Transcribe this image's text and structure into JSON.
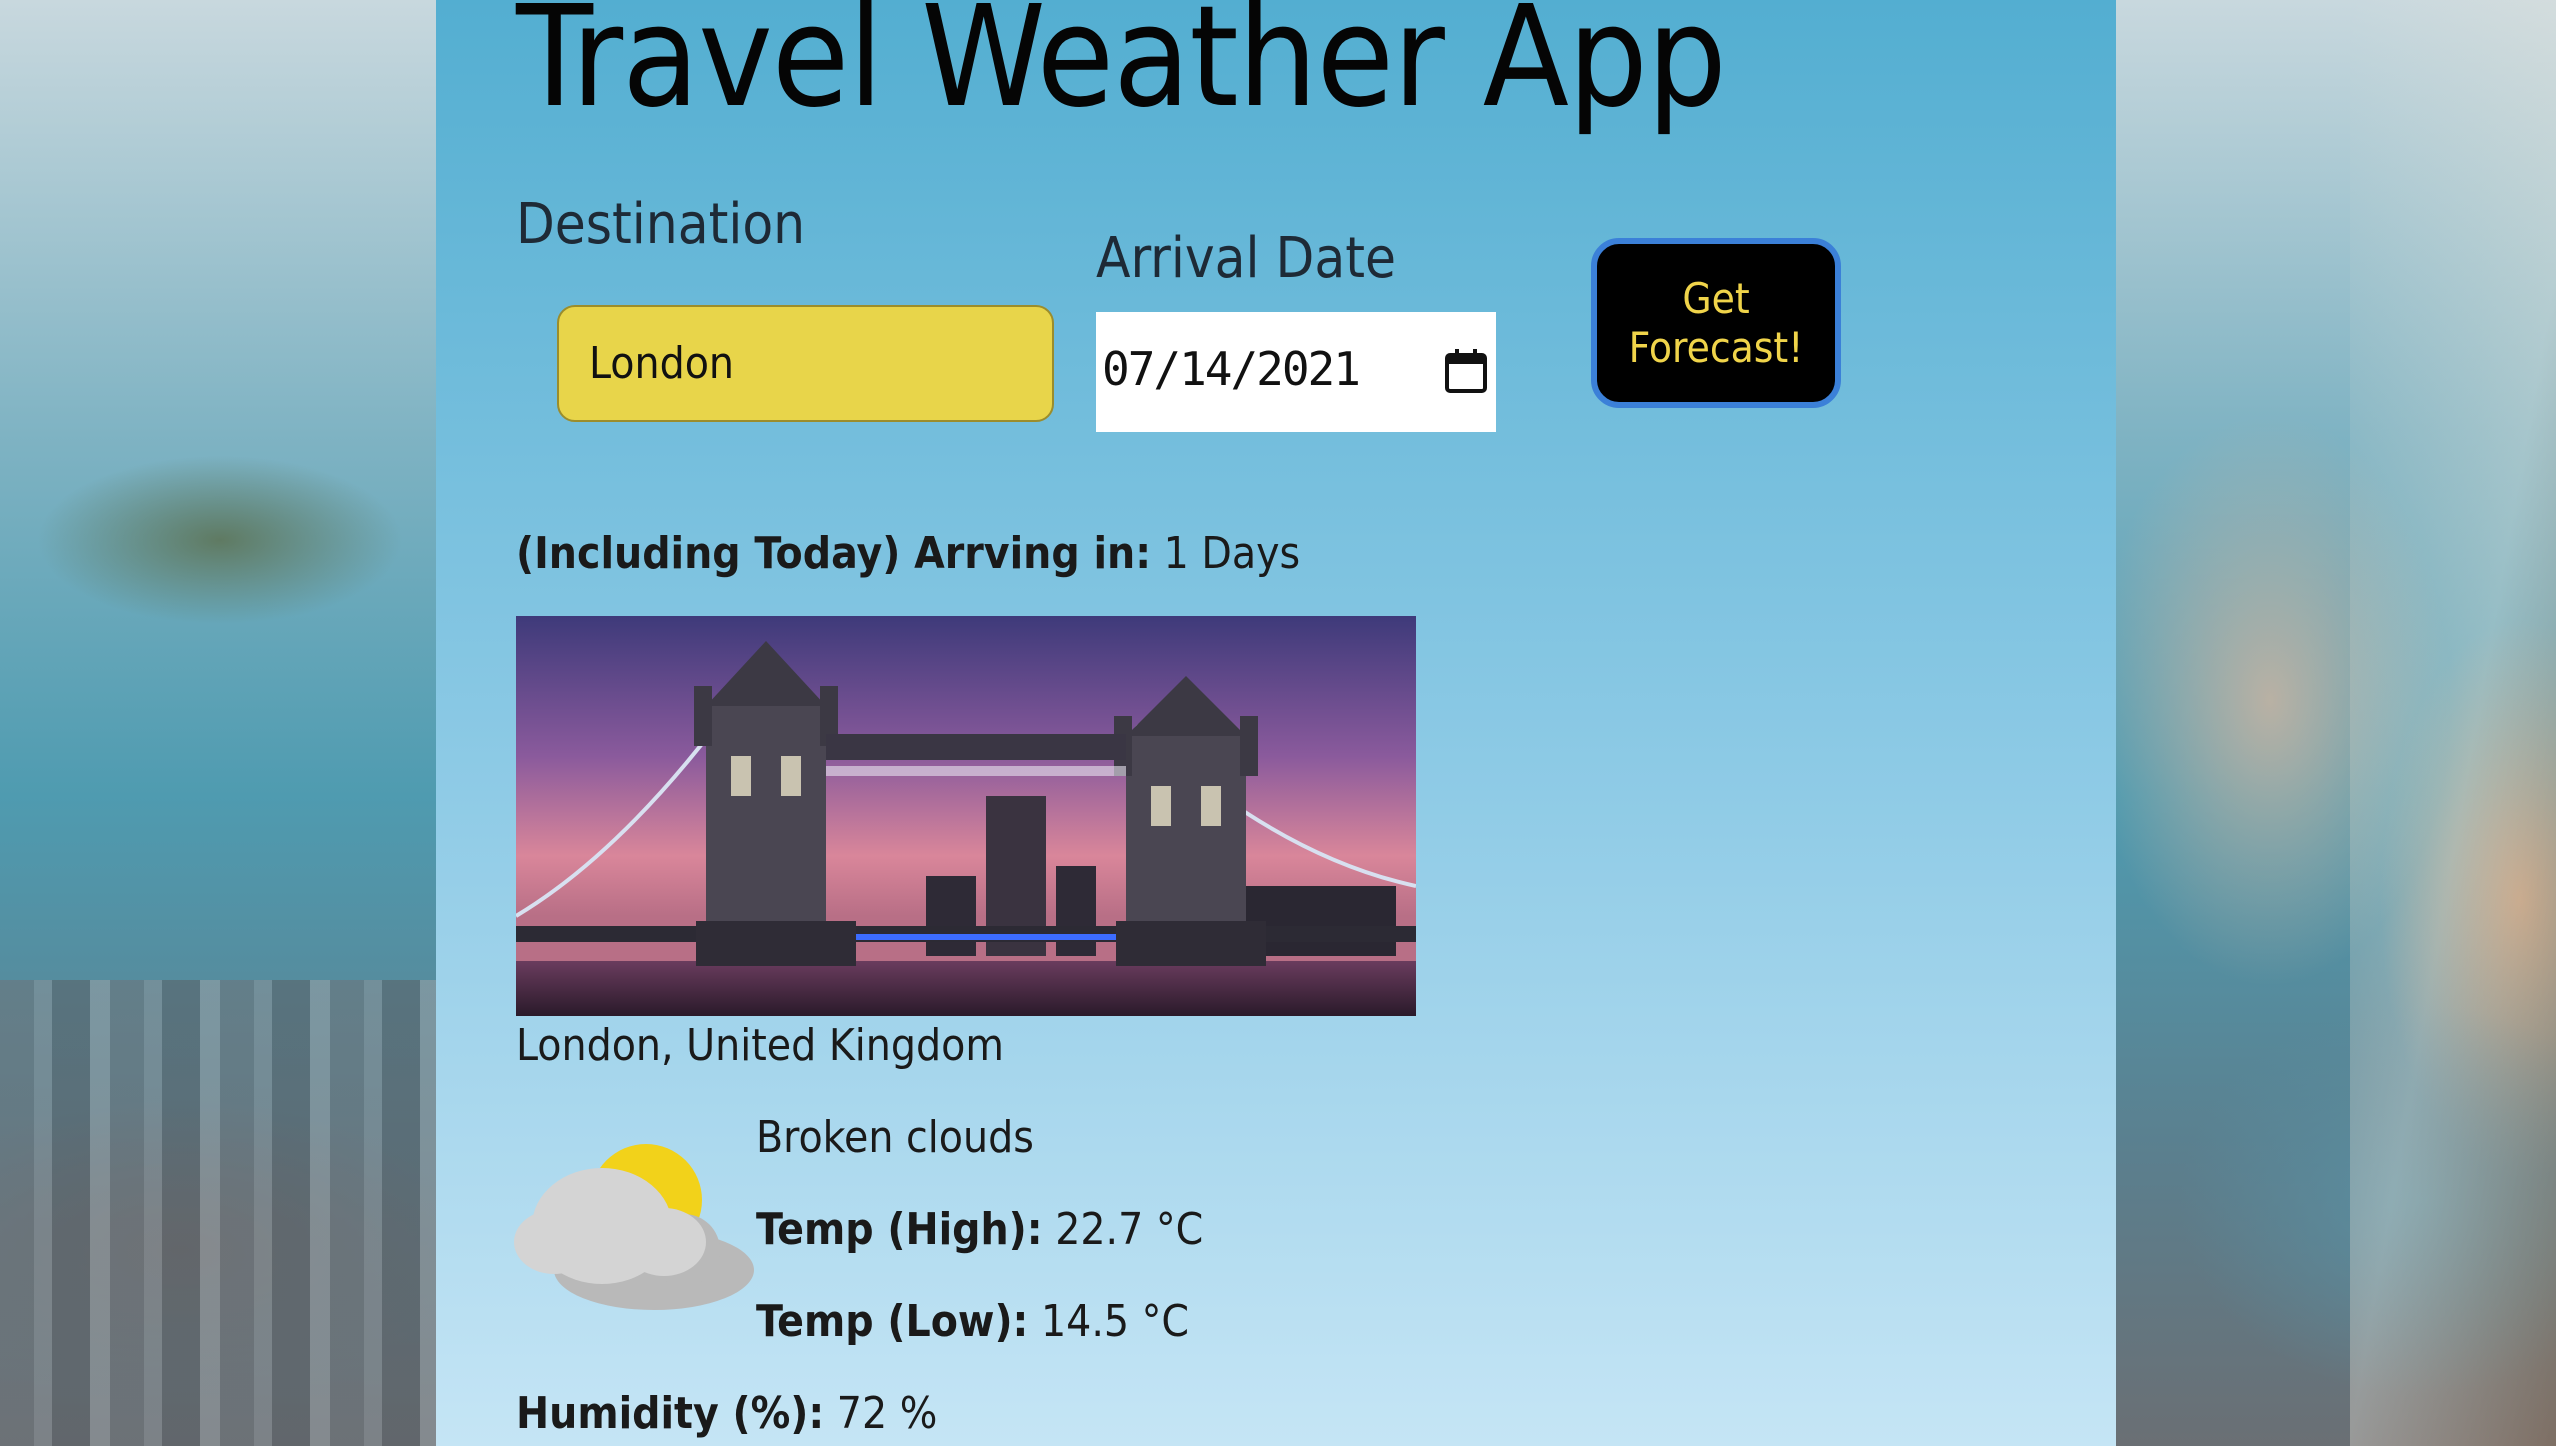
{
  "app": {
    "title": "Travel Weather App"
  },
  "form": {
    "destination_label": "Destination",
    "destination_value": "London",
    "arrival_label": "Arrival Date",
    "arrival_value": "07/14/2021",
    "submit_label": "Get Forecast!"
  },
  "trip": {
    "arriving_label": "(Including Today) Arrving in:",
    "arriving_value": "1 Days"
  },
  "destination": {
    "location": "London, United Kingdom"
  },
  "weather": {
    "description": "Broken clouds",
    "high_label": "Temp (High):",
    "high_value": "22.7 °C",
    "low_label": "Temp (Low):",
    "low_value": "14.5 °C",
    "humidity_label": "Humidity (%):",
    "humidity_value": "72 %",
    "icon": "broken-clouds-icon"
  },
  "colors": {
    "panel_top": "#53aed1",
    "panel_bottom": "#c5e5f5",
    "input_bg": "#e8d54a",
    "button_bg": "#000000",
    "button_text": "#f0d44a",
    "button_border": "#3b80d8"
  }
}
